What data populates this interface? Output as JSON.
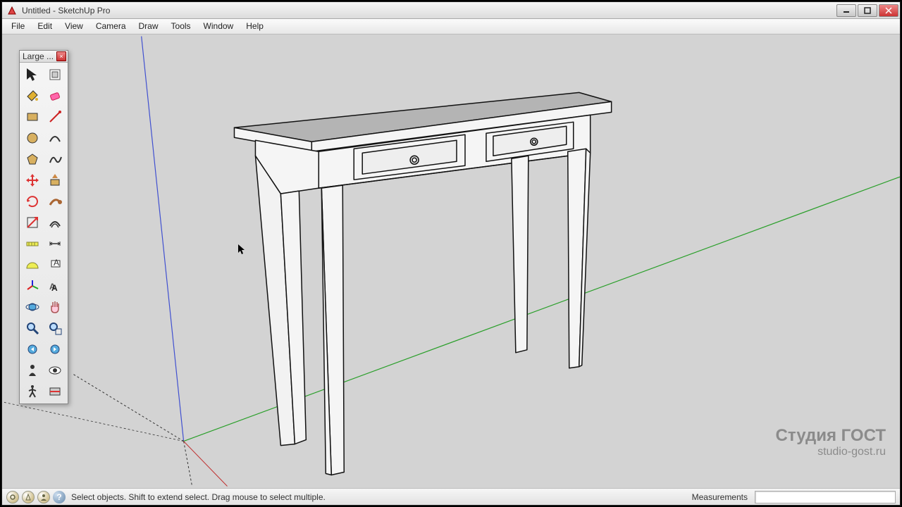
{
  "window": {
    "title": "Untitled - SketchUp Pro"
  },
  "menu": [
    "File",
    "Edit",
    "View",
    "Camera",
    "Draw",
    "Tools",
    "Window",
    "Help"
  ],
  "toolbox": {
    "title": "Large ...",
    "tools": [
      "select",
      "make-component",
      "paint-bucket",
      "eraser",
      "rectangle",
      "line",
      "circle",
      "arc",
      "polygon",
      "freehand",
      "move",
      "push-pull",
      "rotate",
      "follow-me",
      "scale",
      "offset",
      "tape-measure",
      "dimension",
      "protractor",
      "text",
      "axes",
      "3d-text",
      "orbit",
      "pan",
      "zoom",
      "zoom-extents",
      "previous",
      "next",
      "position-camera",
      "look-around",
      "walk",
      "section-plane"
    ]
  },
  "status": {
    "hint": "Select objects. Shift to extend select. Drag mouse to select multiple.",
    "measurements_label": "Measurements",
    "measurements_value": ""
  },
  "watermark": {
    "line1": "Студия ГОСТ",
    "line2": "studio-gost.ru"
  },
  "viewport": {
    "model": "console-table",
    "description": "3D model of a console table with two drawers, tapered legs",
    "axes_visible": true
  }
}
